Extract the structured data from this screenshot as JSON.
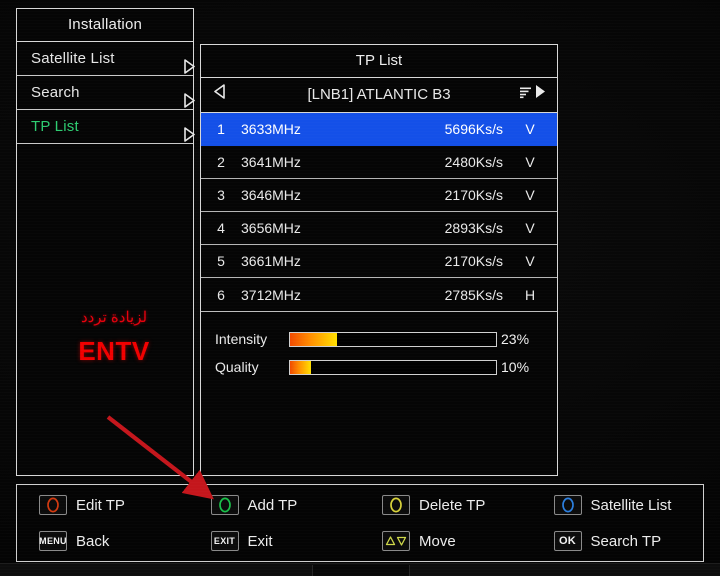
{
  "menu": {
    "title": "Installation",
    "items": [
      {
        "label": "Satellite List",
        "arrow_icon": "chevron-right-icon",
        "active": false
      },
      {
        "label": "Search",
        "arrow_icon": "chevron-right-icon",
        "active": false
      },
      {
        "label": "TP List",
        "arrow_icon": "chevron-right-icon",
        "active": true
      }
    ]
  },
  "tp_panel": {
    "title": "TP List",
    "satellite": "[LNB1] ATLANTIC B3",
    "nav_left_icon": "triangle-left-icon",
    "nav_right_icon": "triangle-right-icon",
    "sort_icon": "sort-list-icon",
    "rows": [
      {
        "index": "1",
        "frequency": "3633MHz",
        "symbol_rate": "5696Ks/s",
        "polarization": "V",
        "selected": true
      },
      {
        "index": "2",
        "frequency": "3641MHz",
        "symbol_rate": "2480Ks/s",
        "polarization": "V",
        "selected": false
      },
      {
        "index": "3",
        "frequency": "3646MHz",
        "symbol_rate": "2170Ks/s",
        "polarization": "V",
        "selected": false
      },
      {
        "index": "4",
        "frequency": "3656MHz",
        "symbol_rate": "2893Ks/s",
        "polarization": "V",
        "selected": false
      },
      {
        "index": "5",
        "frequency": "3661MHz",
        "symbol_rate": "2170Ks/s",
        "polarization": "V",
        "selected": false
      },
      {
        "index": "6",
        "frequency": "3712MHz",
        "symbol_rate": "2785Ks/s",
        "polarization": "H",
        "selected": false
      }
    ],
    "meters": [
      {
        "label": "Intensity",
        "percent_text": "23%",
        "percent": 23
      },
      {
        "label": "Quality",
        "percent_text": "10%",
        "percent": 10
      }
    ]
  },
  "legend": {
    "items": [
      {
        "label": "Edit TP",
        "badge_type": "circle",
        "badge_text": "",
        "icon": "red-circle-button-icon",
        "color": "#d33a10"
      },
      {
        "label": "Add TP",
        "badge_type": "circle",
        "badge_text": "",
        "icon": "green-circle-button-icon",
        "color": "#19c24a"
      },
      {
        "label": "Delete TP",
        "badge_type": "circle",
        "badge_text": "",
        "icon": "yellow-circle-button-icon",
        "color": "#d8d23a"
      },
      {
        "label": "Satellite List",
        "badge_type": "circle",
        "badge_text": "",
        "icon": "blue-circle-button-icon",
        "color": "#2b7fe0"
      },
      {
        "label": "Back",
        "badge_type": "text",
        "badge_text": "MENU",
        "icon": "menu-key-icon",
        "color": "#f2f2f2"
      },
      {
        "label": "Exit",
        "badge_type": "text",
        "badge_text": "EXIT",
        "icon": "exit-key-icon",
        "color": "#f2f2f2"
      },
      {
        "label": "Move",
        "badge_type": "arrows",
        "badge_text": "",
        "icon": "up-down-arrows-icon",
        "color": "#cfd84a"
      },
      {
        "label": "Search TP",
        "badge_type": "text",
        "badge_text": "OK",
        "icon": "ok-key-icon",
        "color": "#f2f2f2"
      }
    ]
  },
  "annotations": {
    "arabic_text": "لزيادة تردد",
    "channel_text": "ENTV",
    "arrow_icon": "red-arrow-icon",
    "arrow_color": "#c4161c"
  },
  "colors": {
    "selection_blue": "#1450e8",
    "active_green": "#2ecc71",
    "meter_gradient_start": "#f04a00",
    "meter_gradient_end": "#ffe000",
    "annotation_red": "#f10000"
  }
}
